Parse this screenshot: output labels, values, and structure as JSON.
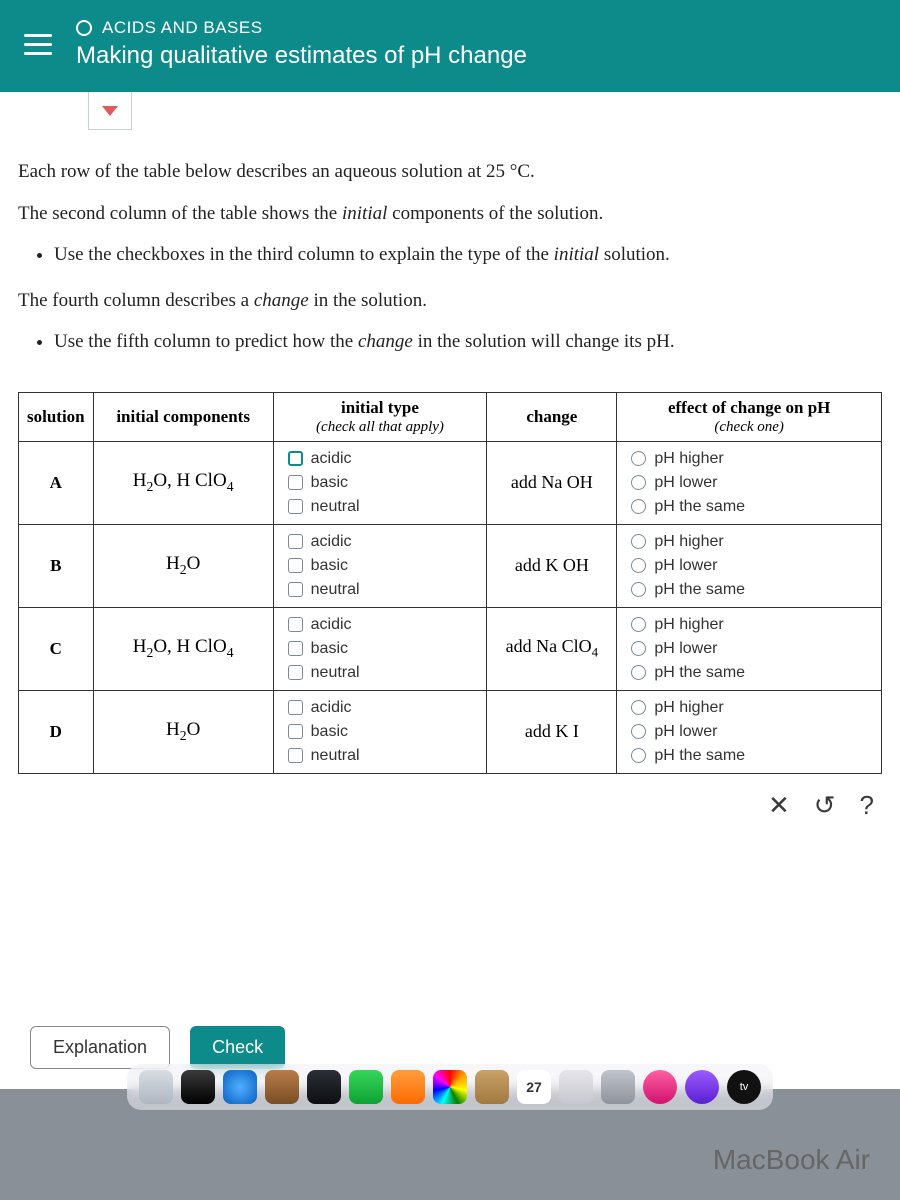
{
  "header": {
    "topic": "ACIDS AND BASES",
    "title": "Making qualitative estimates of pH change"
  },
  "intro": {
    "p1a": "Each row of the table below describes an aqueous solution at ",
    "p1b": "25 °C",
    "p1c": ".",
    "p2a": "The second column of the table shows the ",
    "p2b": "initial",
    "p2c": " components of the solution.",
    "b1a": "Use the checkboxes in the third column to explain the type of the ",
    "b1b": "initial",
    "b1c": " solution.",
    "p3a": "The fourth column describes a ",
    "p3b": "change",
    "p3c": " in the solution.",
    "b2a": "Use the fifth column to predict how the ",
    "b2b": "change",
    "b2c": " in the solution will change its pH."
  },
  "table": {
    "headers": {
      "solution": "solution",
      "components": "initial components",
      "type": "initial type",
      "type_sub": "(check all that apply)",
      "change": "change",
      "effect": "effect of change on pH",
      "effect_sub": "(check one)"
    },
    "type_options": [
      "acidic",
      "basic",
      "neutral"
    ],
    "effect_options": [
      "pH higher",
      "pH lower",
      "pH the same"
    ],
    "rows": [
      {
        "id": "A",
        "components_html": "H<span class='sub-n'>2</span>O, H ClO<span class='sub-n'>4</span>",
        "change_html": "add Na OH"
      },
      {
        "id": "B",
        "components_html": "H<span class='sub-n'>2</span>O",
        "change_html": "add K OH"
      },
      {
        "id": "C",
        "components_html": "H<span class='sub-n'>2</span>O, H ClO<span class='sub-n'>4</span>",
        "change_html": "add Na ClO<span class='sub-n'>4</span>"
      },
      {
        "id": "D",
        "components_html": "H<span class='sub-n'>2</span>O",
        "change_html": "add K I"
      }
    ]
  },
  "helpbar": {
    "close": "✕",
    "undo": "↺",
    "help": "?"
  },
  "buttons": {
    "explain": "Explanation",
    "check": "Check"
  },
  "dock_badge": "27",
  "device": "MacBook Air"
}
